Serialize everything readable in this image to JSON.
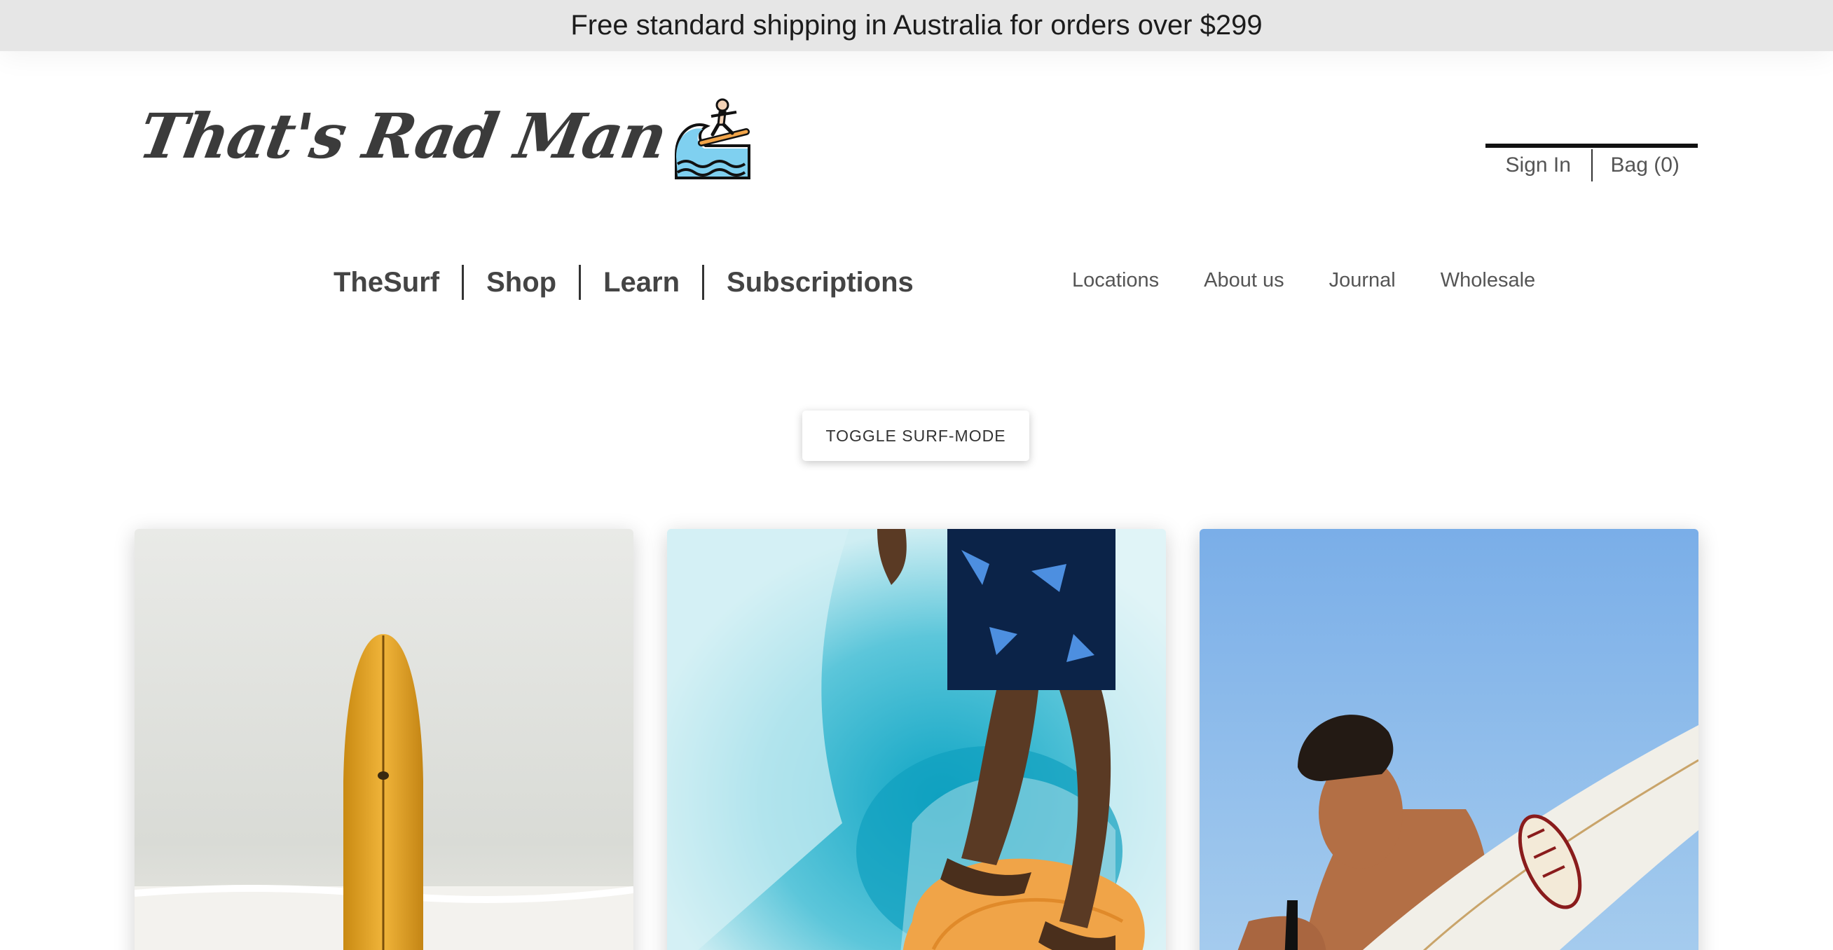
{
  "promo": {
    "text": "Free standard shipping in Australia for orders over $299"
  },
  "logo": {
    "text": "That's Rad Man",
    "icon": "surfer-on-wave-icon"
  },
  "account": {
    "sign_in": "Sign In",
    "bag": "Bag (0)"
  },
  "main_nav": {
    "items": [
      {
        "label": "TheSurf"
      },
      {
        "label": "Shop"
      },
      {
        "label": "Learn"
      },
      {
        "label": "Subscriptions"
      }
    ]
  },
  "secondary_nav": {
    "items": [
      {
        "label": "Locations"
      },
      {
        "label": "About us"
      },
      {
        "label": "Journal"
      },
      {
        "label": "Wholesale"
      }
    ]
  },
  "toggle": {
    "label": "TOGGLE SURF-MODE"
  },
  "cards": [
    {
      "image": "yellow-surfboard-on-beach"
    },
    {
      "image": "surfer-feet-on-board-in-wave"
    },
    {
      "image": "surfer-carrying-surfboard-sky"
    }
  ],
  "colors": {
    "promo_bg": "#e6e6e6",
    "text": "#444444",
    "sky": "#8fb6e3",
    "water": "#19a7c4"
  }
}
